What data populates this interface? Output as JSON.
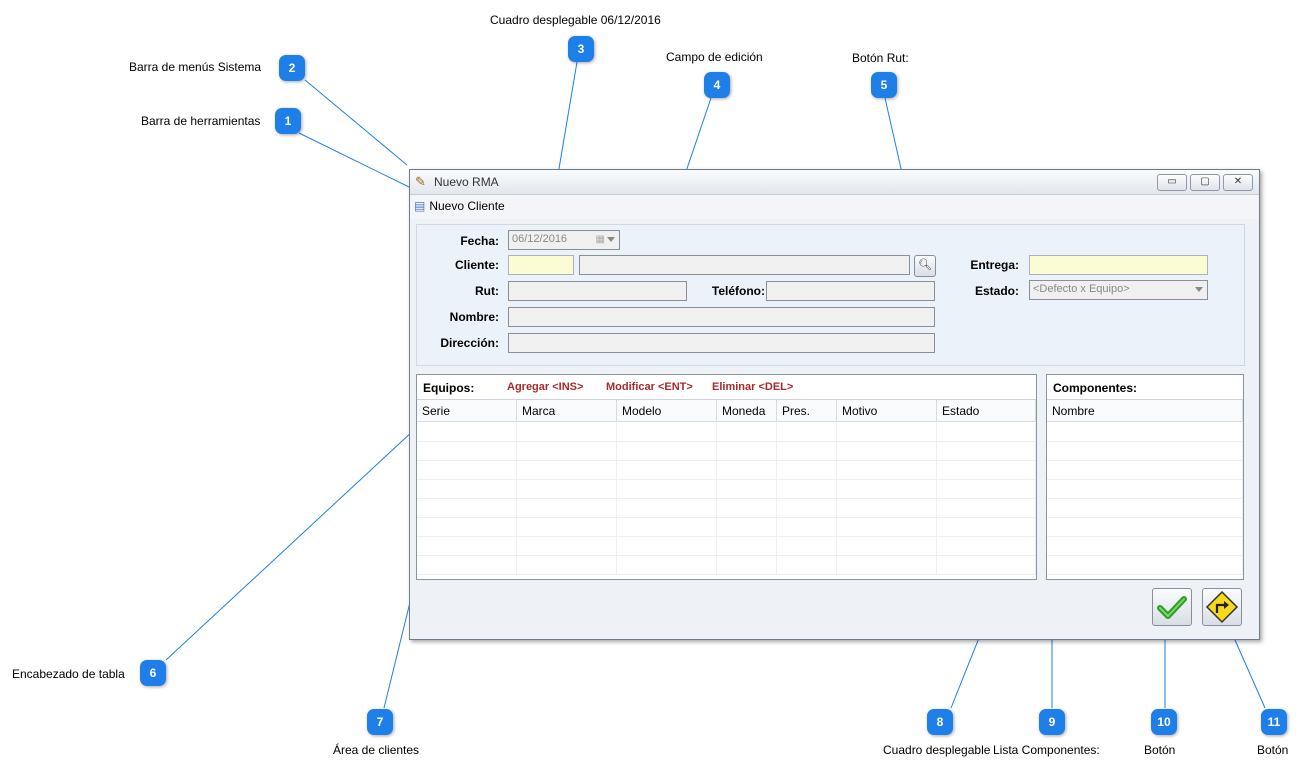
{
  "annotations": [
    {
      "number": "1",
      "label": "Barra de herramientas"
    },
    {
      "number": "2",
      "label": "Barra de menús Sistema"
    },
    {
      "number": "3",
      "label": "Cuadro desplegable 06/12/2016"
    },
    {
      "number": "4",
      "label": "Campo de edición"
    },
    {
      "number": "5",
      "label": "Botón Rut:"
    },
    {
      "number": "6",
      "label": "Encabezado de tabla"
    },
    {
      "number": "7",
      "label": "Área de clientes"
    },
    {
      "number": "8",
      "label": "Cuadro desplegable"
    },
    {
      "number": "9",
      "label": "Lista Componentes:"
    },
    {
      "number": "10",
      "label": "Botón"
    },
    {
      "number": "11",
      "label": "Botón"
    }
  ],
  "window": {
    "title": "Nuevo RMA",
    "minimize": "▭",
    "maximize": "▢",
    "close": "✕"
  },
  "menubar": {
    "new_client": "Nuevo Cliente"
  },
  "form": {
    "fecha_label": "Fecha:",
    "fecha_value": "06/12/2016",
    "cliente_label": "Cliente:",
    "cliente_code": "",
    "cliente_name": "",
    "rut_label": "Rut:",
    "rut_value": "",
    "telefono_label": "Teléfono:",
    "telefono_value": "",
    "nombre_label": "Nombre:",
    "nombre_value": "",
    "direccion_label": "Dirección:",
    "direccion_value": "",
    "entrega_label": "Entrega:",
    "entrega_value": "",
    "estado_label": "Estado:",
    "estado_value": "<Defecto x Equipo>"
  },
  "equipos": {
    "title": "Equipos:",
    "add": "Agregar <INS>",
    "modify": "Modificar <ENT>",
    "delete": "Eliminar <DEL>",
    "columns": [
      "Serie",
      "Marca",
      "Modelo",
      "Moneda",
      "Pres.",
      "Motivo",
      "Estado"
    ],
    "rows": []
  },
  "componentes": {
    "title": "Componentes:",
    "columns": [
      "Nombre"
    ],
    "rows": []
  },
  "icons": {
    "app": "pencil-icon",
    "new_client": "contact-card-icon",
    "search": "magnifier-icon",
    "ok": "green-check-icon",
    "exit": "exit-arrow-icon"
  },
  "colors": {
    "callout": "#1e7fe8",
    "action_text": "#a52a2a",
    "yellow_field": "#fbfbd4"
  }
}
